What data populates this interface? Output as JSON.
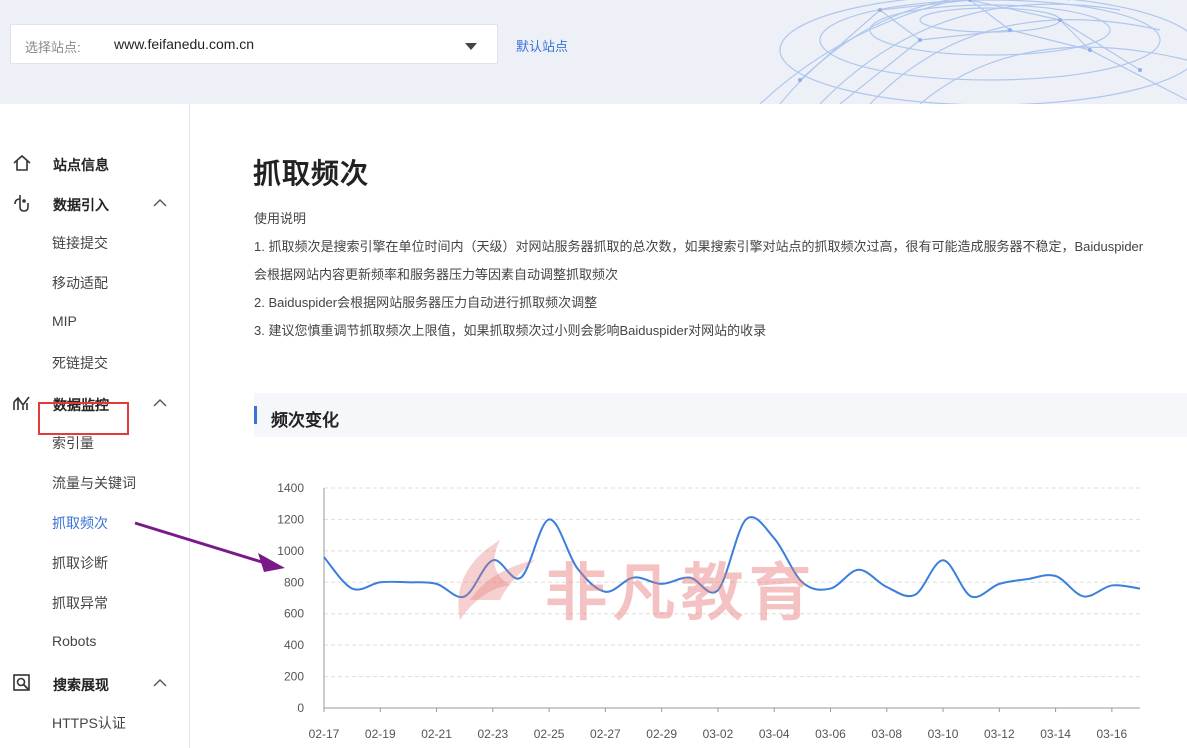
{
  "header": {
    "site_label": "选择站点:",
    "site_value": "www.feifanedu.com.cn",
    "default_site": "默认站点"
  },
  "sidebar": {
    "sections": [
      {
        "label": "站点信息",
        "icon": "home-icon"
      },
      {
        "label": "数据引入",
        "icon": "data-import-icon",
        "items": [
          "链接提交",
          "移动适配",
          "MIP",
          "死链提交"
        ]
      },
      {
        "label": "数据监控",
        "icon": "monitor-icon",
        "items": [
          "索引量",
          "流量与关键词",
          "抓取频次",
          "抓取诊断",
          "抓取异常",
          "Robots"
        ]
      },
      {
        "label": "搜索展现",
        "icon": "search-display-icon",
        "items": [
          "HTTPS认证"
        ]
      }
    ],
    "active_item": "抓取频次"
  },
  "main": {
    "title": "抓取频次",
    "usage_title": "使用说明",
    "lines": [
      "1. 抓取频次是搜索引擎在单位时间内（天级）对网站服务器抓取的总次数，如果搜索引擎对站点的抓取频次过高，很有可能造成服务器不稳定，Baiduspider",
      "会根据网站内容更新频率和服务器压力等因素自动调整抓取频次",
      "2. Baiduspider会根据网站服务器压力自动进行抓取频次调整",
      "3. 建议您慎重调节抓取频次上限值，如果抓取频次过小则会影响Baiduspider对网站的收录"
    ],
    "section_title": "频次变化",
    "watermark": "非凡教育"
  },
  "colors": {
    "accent": "#3a72d8",
    "line": "#3a7fdb",
    "highlight_box": "#e33b3b",
    "arrow": "#7a1a8a"
  },
  "chart_data": {
    "type": "line",
    "yticks": [
      0,
      200,
      400,
      600,
      800,
      1000,
      1200,
      1400
    ],
    "ylim": [
      0,
      1400
    ],
    "xticks": [
      "02-17",
      "02-19",
      "02-21",
      "02-23",
      "02-25",
      "02-27",
      "02-29",
      "03-02",
      "03-04",
      "03-06",
      "03-08",
      "03-10",
      "03-12",
      "03-14",
      "03-16"
    ],
    "x": [
      "02-17",
      "02-18",
      "02-19",
      "02-20",
      "02-21",
      "02-22",
      "02-23",
      "02-24",
      "02-25",
      "02-26",
      "02-27",
      "02-28",
      "02-29",
      "03-01",
      "03-02",
      "03-03",
      "03-04",
      "03-05",
      "03-06",
      "03-07",
      "03-08",
      "03-09",
      "03-10",
      "03-11",
      "03-12",
      "03-13",
      "03-14",
      "03-15",
      "03-16",
      "03-17"
    ],
    "values": [
      960,
      760,
      800,
      800,
      790,
      710,
      940,
      830,
      1200,
      890,
      740,
      830,
      790,
      830,
      750,
      1200,
      1080,
      800,
      760,
      880,
      770,
      720,
      940,
      710,
      790,
      820,
      840,
      710,
      780,
      760
    ]
  }
}
